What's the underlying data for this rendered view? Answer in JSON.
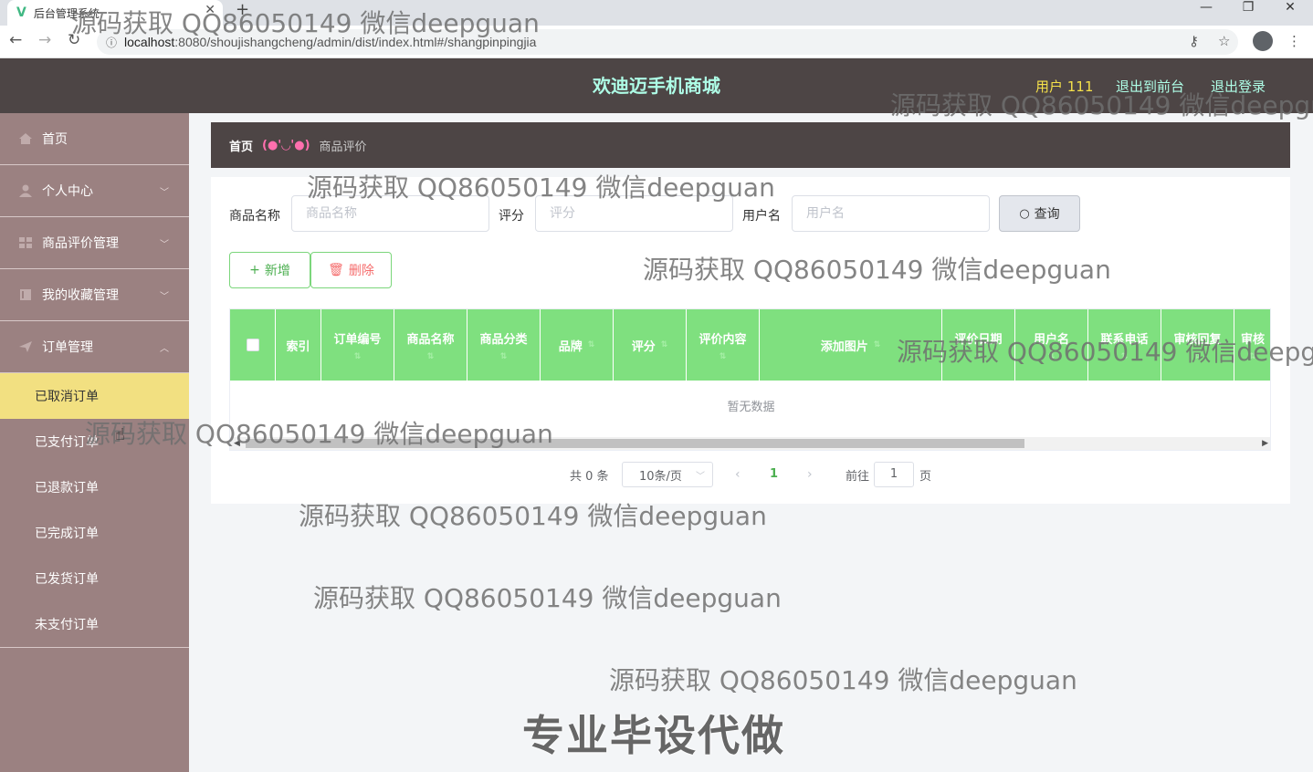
{
  "browser": {
    "tab_title": "后台管理系统",
    "tab_close": "✕",
    "new_tab": "+",
    "url_host": "localhost",
    "url_rest": ":8080/shoujishangcheng/admin/dist/index.html#/shangpinpingjia"
  },
  "header": {
    "title": "欢迪迈手机商城",
    "user": "用户 111",
    "to_front": "退出到前台",
    "logout": "退出登录"
  },
  "sidebar": {
    "items": [
      {
        "label": "首页",
        "icon": "home-icon"
      },
      {
        "label": "个人中心",
        "icon": "user-icon"
      },
      {
        "label": "商品评价管理",
        "icon": "grid-icon"
      },
      {
        "label": "我的收藏管理",
        "icon": "book-icon"
      },
      {
        "label": "订单管理",
        "icon": "send-icon"
      }
    ],
    "order_sub": [
      {
        "label": "已取消订单",
        "active": true
      },
      {
        "label": "已支付订单",
        "active": false
      },
      {
        "label": "已退款订单",
        "active": false
      },
      {
        "label": "已完成订单",
        "active": false
      },
      {
        "label": "已发货订单",
        "active": false
      },
      {
        "label": "未支付订单",
        "active": false
      }
    ]
  },
  "breadcrumb": {
    "home": "首页",
    "sep": "(●'◡'●)",
    "current": "商品评价"
  },
  "search": {
    "name_label": "商品名称",
    "name_placeholder": "商品名称",
    "score_label": "评分",
    "score_placeholder": "评分",
    "user_label": "用户名",
    "user_placeholder": "用户名",
    "button": "查询"
  },
  "actions": {
    "add": "新增",
    "delete": "删除"
  },
  "table": {
    "columns": [
      "索引",
      "订单编号",
      "商品名称",
      "商品分类",
      "品牌",
      "评分",
      "评价内容",
      "添加图片",
      "评价日期",
      "用户名",
      "联系电话",
      "审核回复",
      "审核"
    ],
    "empty": "暂无数据"
  },
  "pagination": {
    "total": "共 0 条",
    "page_size": "10条/页",
    "current_page": "1",
    "goto_label": "前往",
    "goto_value": "1",
    "page_suffix": "页"
  },
  "watermarks": {
    "text": "源码获取 QQ86050149 微信deepguan",
    "big": "专业毕设代做"
  }
}
